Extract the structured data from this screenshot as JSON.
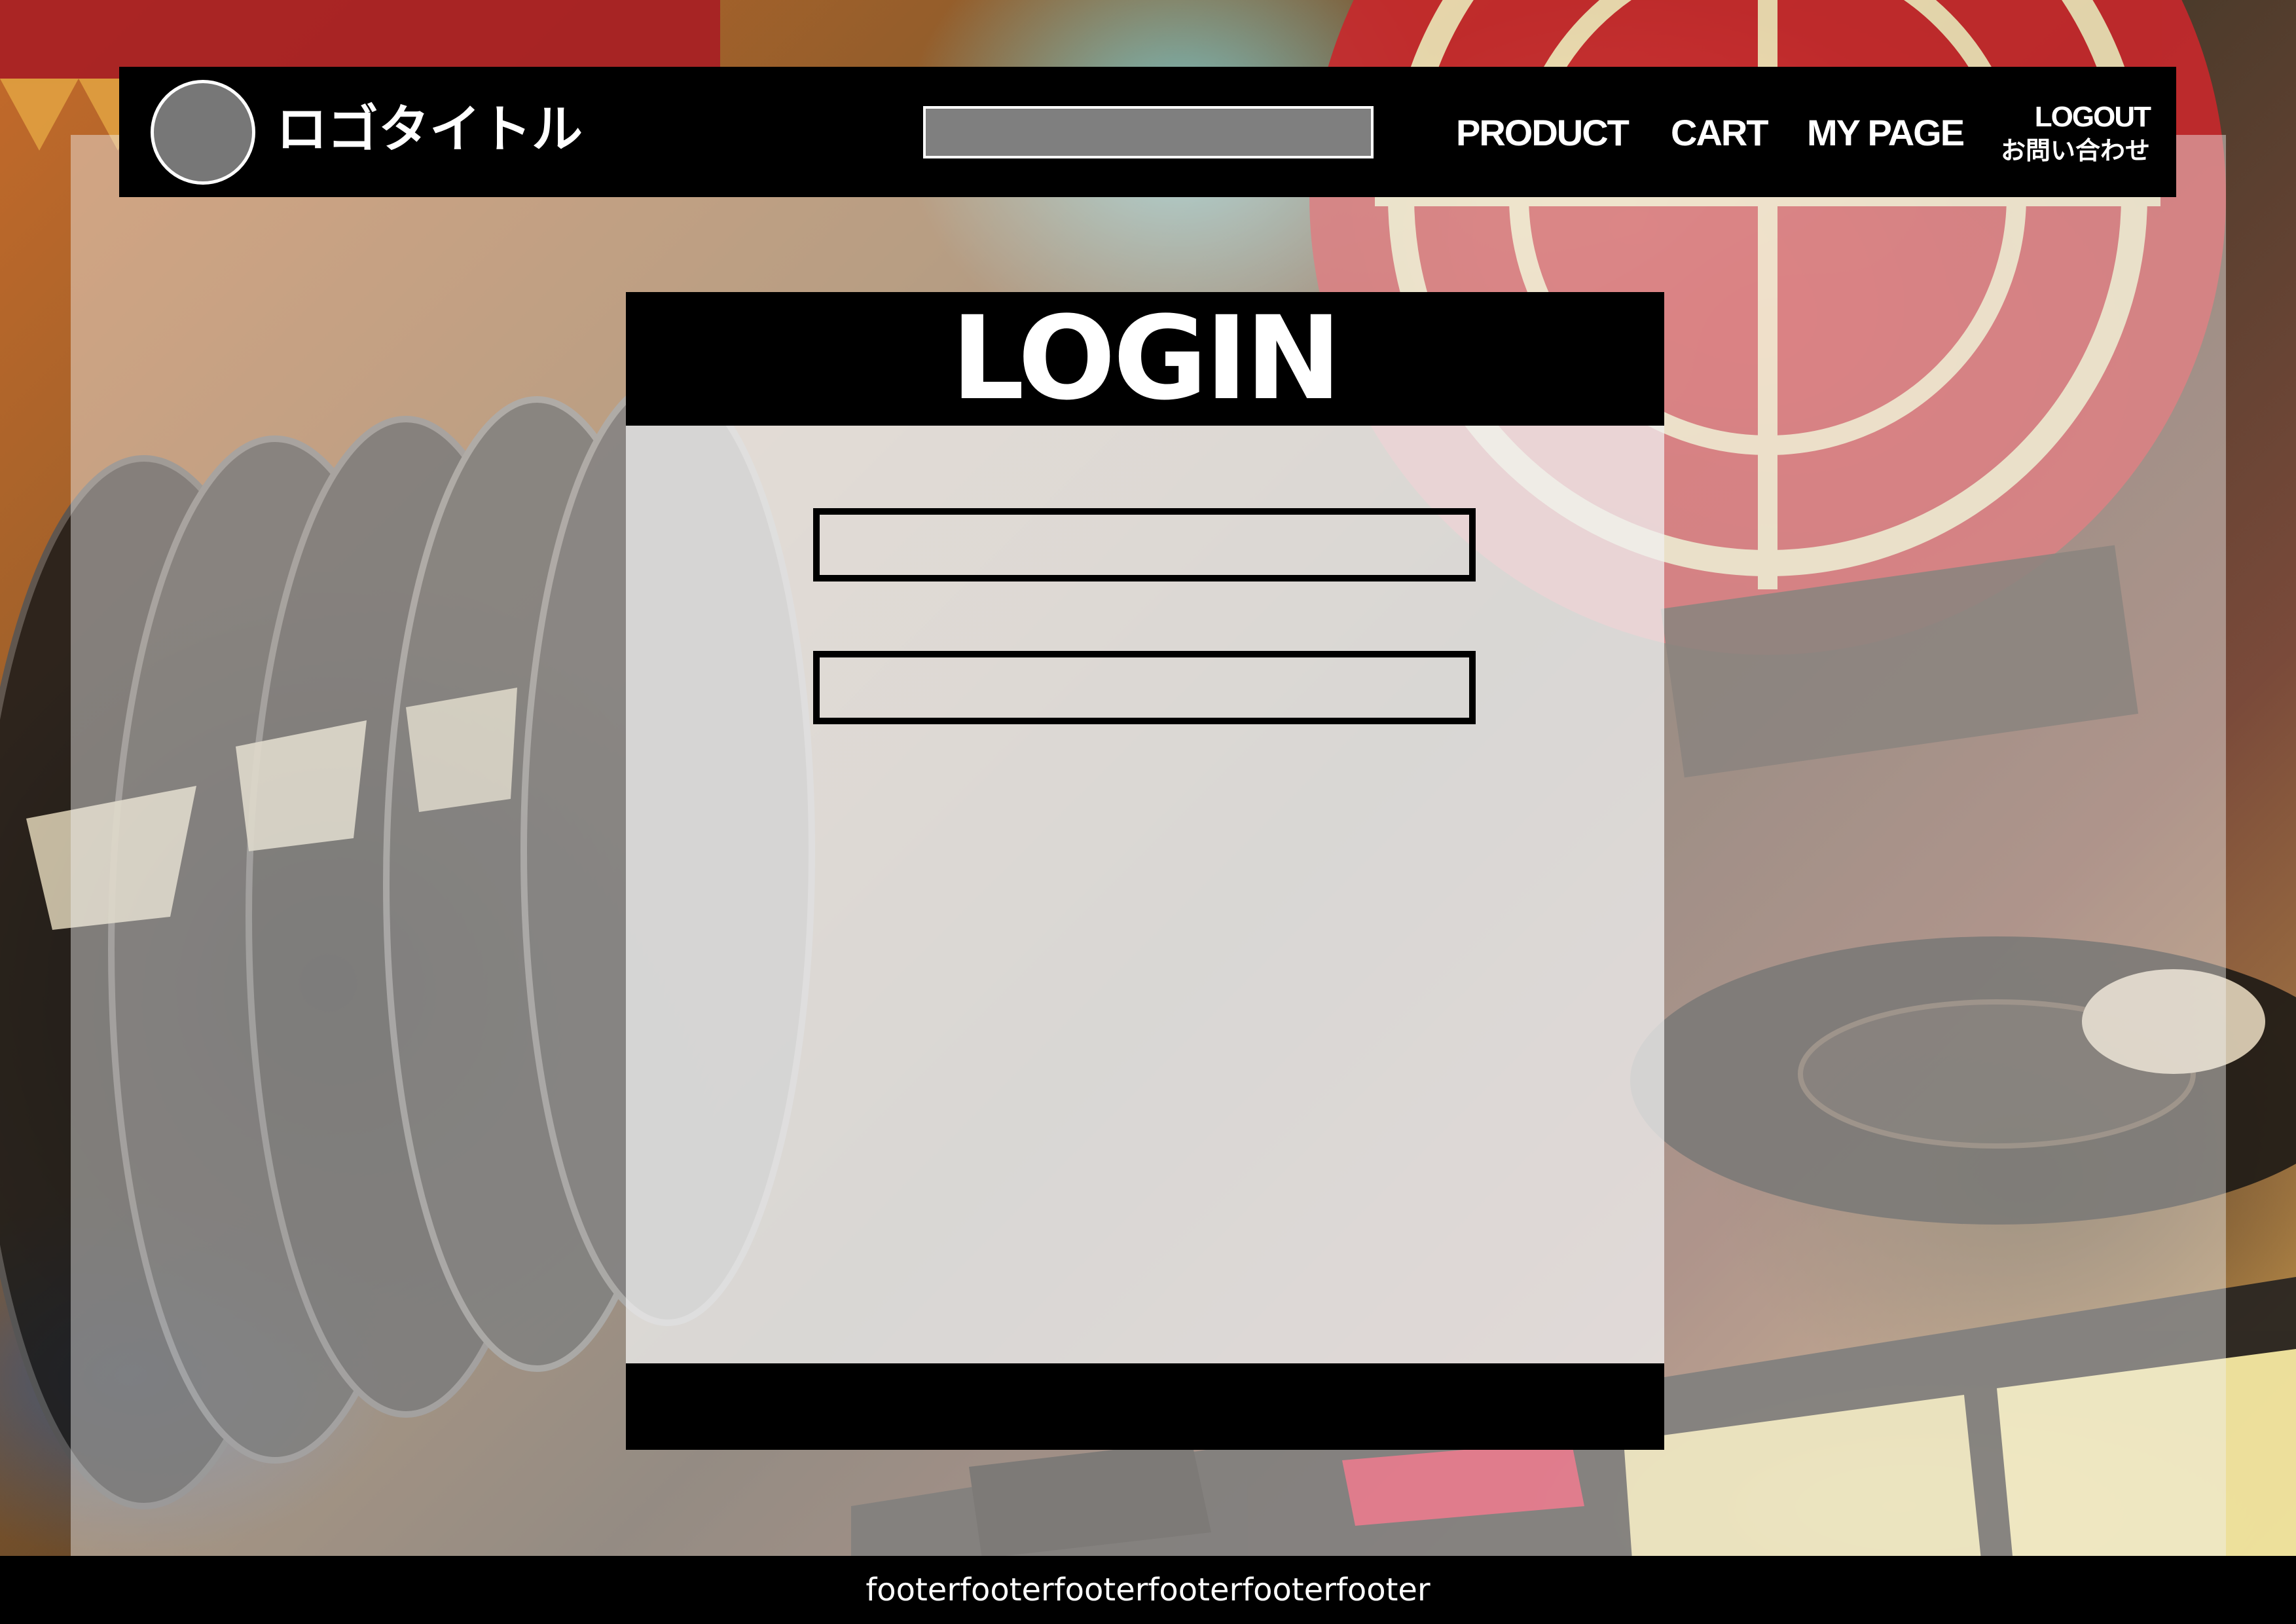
{
  "header": {
    "logo_title": "ロゴタイトル",
    "search": {
      "value": "",
      "placeholder": ""
    },
    "nav": {
      "product": "PRODUCT",
      "cart": "CART",
      "my_page": "MY PAGE",
      "logout": "LOGOUT",
      "contact": "お問い合わせ"
    }
  },
  "login": {
    "title": "LOGIN",
    "field_1": {
      "value": "",
      "placeholder": ""
    },
    "field_2": {
      "value": "",
      "placeholder": ""
    }
  },
  "footer": {
    "text": "footerfooterfooterfooterfooterfooter"
  },
  "colors": {
    "header_bg": "#000000",
    "text_primary": "#ffffff",
    "logo_circle": "#777777",
    "search_box": "#7f7f7f",
    "panel_overlay": "rgba(240,240,240,0.45)"
  }
}
